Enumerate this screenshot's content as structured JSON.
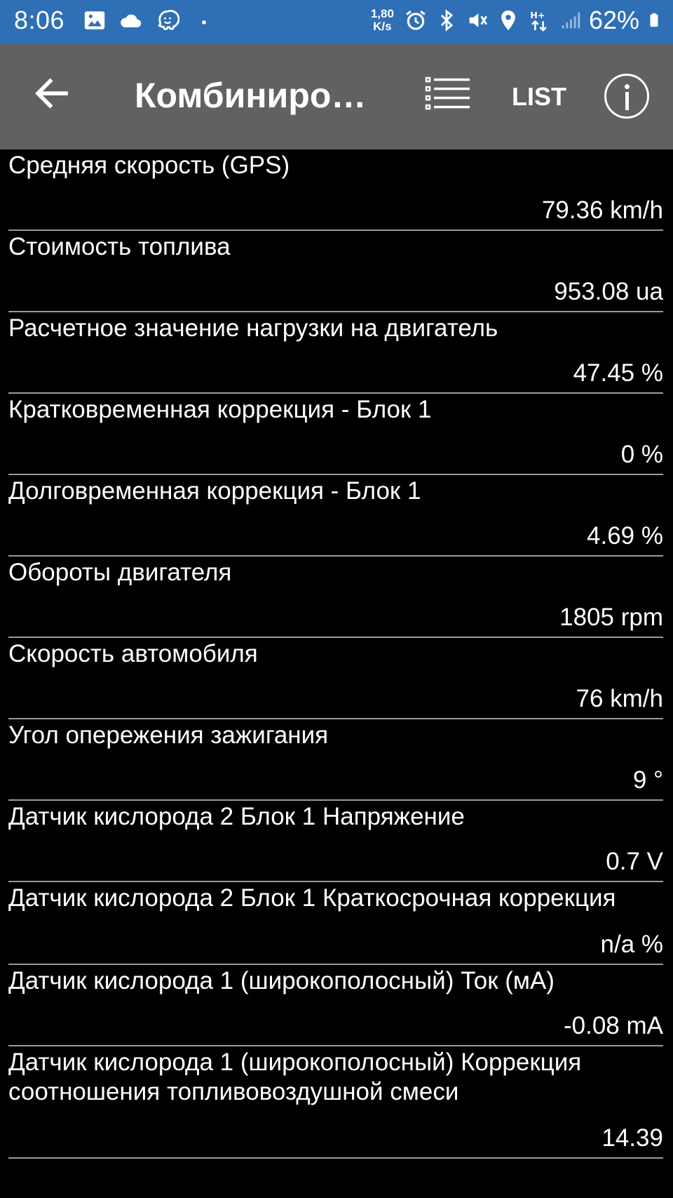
{
  "status_bar": {
    "time": "8:06",
    "net_speed_value": "1,80",
    "net_speed_unit": "K/s",
    "network_type": "H+",
    "battery_percent": "62%",
    "icons": [
      "gallery-icon",
      "cloud-icon",
      "waze-icon",
      "dot-icon",
      "alarm-icon",
      "bluetooth-icon",
      "mute-icon",
      "location-icon",
      "data-arrows-icon",
      "signal-icon",
      "battery-icon"
    ]
  },
  "app_bar": {
    "title": "Комбиниров…",
    "list_label": "LIST",
    "icons": [
      "back-arrow-icon",
      "list-view-icon",
      "info-icon"
    ]
  },
  "sensors": [
    {
      "name": "Средняя скорость (GPS)",
      "value": "79.36 km/h"
    },
    {
      "name": "Стоимость топлива",
      "value": "953.08 ua"
    },
    {
      "name": "Расчетное значение нагрузки на двигатель",
      "value": "47.45 %"
    },
    {
      "name": "Кратковременная коррекция - Блок 1",
      "value": "0 %"
    },
    {
      "name": "Долговременная коррекция - Блок 1",
      "value": "4.69 %"
    },
    {
      "name": "Обороты двигателя",
      "value": "1805 rpm"
    },
    {
      "name": "Скорость автомобиля",
      "value": "76 km/h"
    },
    {
      "name": "Угол опережения зажигания",
      "value": "9 °"
    },
    {
      "name": "Датчик кислорода 2 Блок 1 Напряжение",
      "value": "0.7 V"
    },
    {
      "name": "Датчик кислорода 2 Блок 1 Краткосрочная коррекция",
      "value": "n/a %"
    },
    {
      "name": "Датчик кислорода 1 (широкополосный) Ток (мА)",
      "value": "-0.08 mA"
    },
    {
      "name": "Датчик кислорода 1 (широкополосный) Коррекция соотношения топливовоздушной смеси",
      "value": "14.39"
    }
  ]
}
